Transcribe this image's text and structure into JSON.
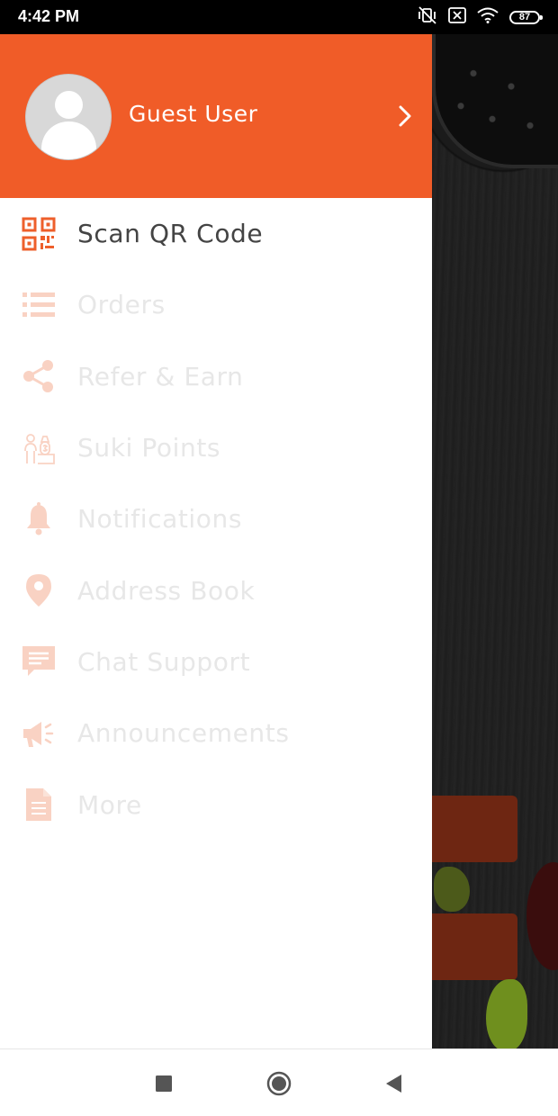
{
  "status_bar": {
    "time": "4:42 PM",
    "battery": "87",
    "icons": [
      "vibrate-off-icon",
      "close-box-icon",
      "wifi-icon",
      "battery-icon"
    ]
  },
  "drawer": {
    "user": {
      "name": "Guest User",
      "avatar_icon": "avatar-placeholder-icon",
      "chevron_icon": "chevron-right-icon"
    },
    "menu": [
      {
        "label": "Scan QR Code",
        "icon": "qr-code-icon",
        "active": true
      },
      {
        "label": "Orders",
        "icon": "list-icon",
        "active": false
      },
      {
        "label": "Refer & Earn",
        "icon": "share-icon",
        "active": false
      },
      {
        "label": "Suki Points",
        "icon": "points-icon",
        "active": false
      },
      {
        "label": "Notifications",
        "icon": "bell-icon",
        "active": false
      },
      {
        "label": "Address Book",
        "icon": "location-pin-icon",
        "active": false
      },
      {
        "label": "Chat Support",
        "icon": "chat-icon",
        "active": false
      },
      {
        "label": "Announcements",
        "icon": "megaphone-icon",
        "active": false
      },
      {
        "label": "More",
        "icon": "document-icon",
        "active": false
      }
    ]
  },
  "nav_bar": {
    "icons": [
      "recent-apps-icon",
      "home-icon",
      "back-icon"
    ]
  },
  "colors": {
    "brand_orange": "#f05c28",
    "icon_active": "#ee5f2b",
    "icon_inactive": "#f9d2c3",
    "label_active": "#444444",
    "label_inactive": "#e7e7e7",
    "background_button": "#6e2612"
  }
}
